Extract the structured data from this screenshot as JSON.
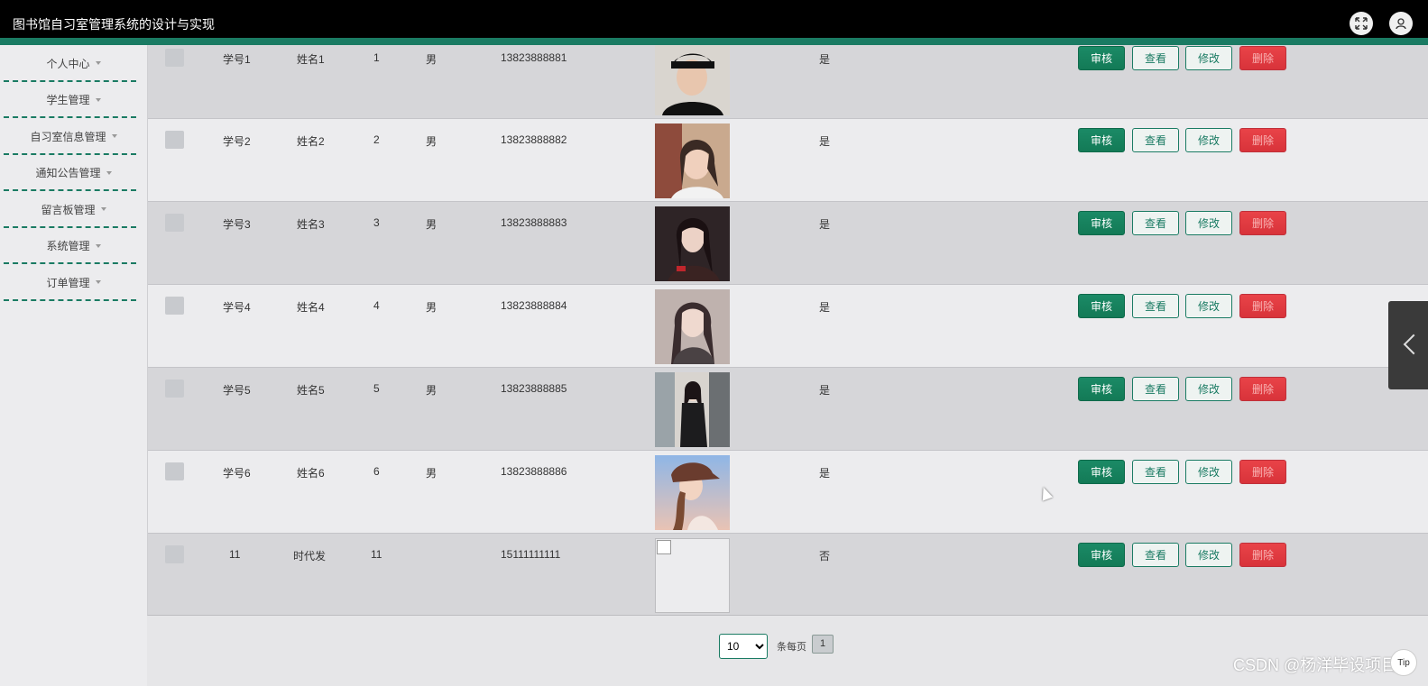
{
  "header": {
    "title": "图书馆自习室管理系统的设计与实现",
    "fullscreen_icon": "expand-icon",
    "user_icon": "user-icon"
  },
  "sidebar": {
    "items": [
      {
        "label": "个人中心"
      },
      {
        "label": "学生管理"
      },
      {
        "label": "自习室信息管理"
      },
      {
        "label": "通知公告管理"
      },
      {
        "label": "留言板管理"
      },
      {
        "label": "系统管理"
      },
      {
        "label": "订单管理"
      }
    ]
  },
  "colors": {
    "accent": "#1a7b63",
    "danger": "#d8333a",
    "header_bg": "#000000"
  },
  "table": {
    "buttons": {
      "audit": "审核",
      "view": "查看",
      "edit": "修改",
      "delete": "删除"
    },
    "rows": [
      {
        "student_no": "学号1",
        "name": "姓名1",
        "num": "1",
        "gender": "男",
        "phone": "13823888881",
        "approved": "是",
        "photo": "photo-person-1"
      },
      {
        "student_no": "学号2",
        "name": "姓名2",
        "num": "2",
        "gender": "男",
        "phone": "13823888882",
        "approved": "是",
        "photo": "photo-person-2"
      },
      {
        "student_no": "学号3",
        "name": "姓名3",
        "num": "3",
        "gender": "男",
        "phone": "13823888883",
        "approved": "是",
        "photo": "photo-person-3"
      },
      {
        "student_no": "学号4",
        "name": "姓名4",
        "num": "4",
        "gender": "男",
        "phone": "13823888884",
        "approved": "是",
        "photo": "photo-person-4"
      },
      {
        "student_no": "学号5",
        "name": "姓名5",
        "num": "5",
        "gender": "男",
        "phone": "13823888885",
        "approved": "是",
        "photo": "photo-person-5"
      },
      {
        "student_no": "学号6",
        "name": "姓名6",
        "num": "6",
        "gender": "男",
        "phone": "13823888886",
        "approved": "是",
        "photo": "photo-person-6"
      },
      {
        "student_no": "11",
        "name": "时代发",
        "num": "11",
        "gender": "",
        "phone": "15111111111",
        "approved": "否",
        "photo": "broken-image"
      }
    ]
  },
  "pagination": {
    "page_size": "10",
    "page_size_options": [
      "10"
    ],
    "per_page_label": "条每页",
    "current_page": "1"
  },
  "watermark": "CSDN @杨洋毕设项目",
  "help_label": "Tip"
}
